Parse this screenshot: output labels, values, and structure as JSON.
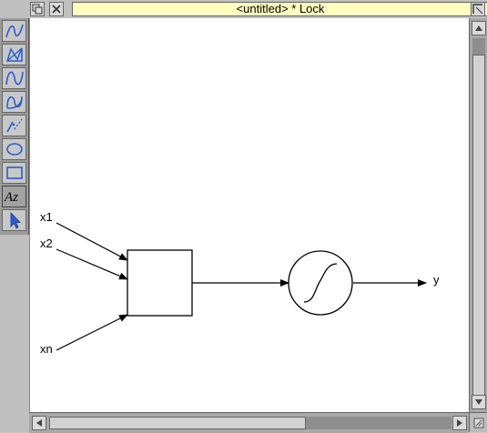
{
  "window": {
    "title": "<untitled> * Lock"
  },
  "title_bar": {
    "back_icon": "back-icon",
    "close_icon": "close-icon",
    "toggle_size_icon": "toggle-size-icon"
  },
  "toolbox": {
    "tools": [
      {
        "icon": "line-tool-icon"
      },
      {
        "icon": "closed-line-tool-icon"
      },
      {
        "icon": "curve-tool-icon"
      },
      {
        "icon": "closed-curve-tool-icon"
      },
      {
        "icon": "move-tool-icon"
      },
      {
        "icon": "ellipse-tool-icon"
      },
      {
        "icon": "rectangle-tool-icon"
      },
      {
        "icon": "text-tool-icon",
        "label": "Az",
        "selected": true
      },
      {
        "icon": "select-tool-icon"
      }
    ]
  },
  "diagram": {
    "inputs": [
      "x1",
      "x2",
      "xn"
    ],
    "output": "y"
  },
  "scrollbars": {
    "vertical": {
      "position": 0.0
    },
    "horizontal": {
      "position": 0.0
    }
  },
  "colors": {
    "title_field": "#ffffc0",
    "tool_icon": "#2b5cd0",
    "canvas": "#ffffff"
  }
}
